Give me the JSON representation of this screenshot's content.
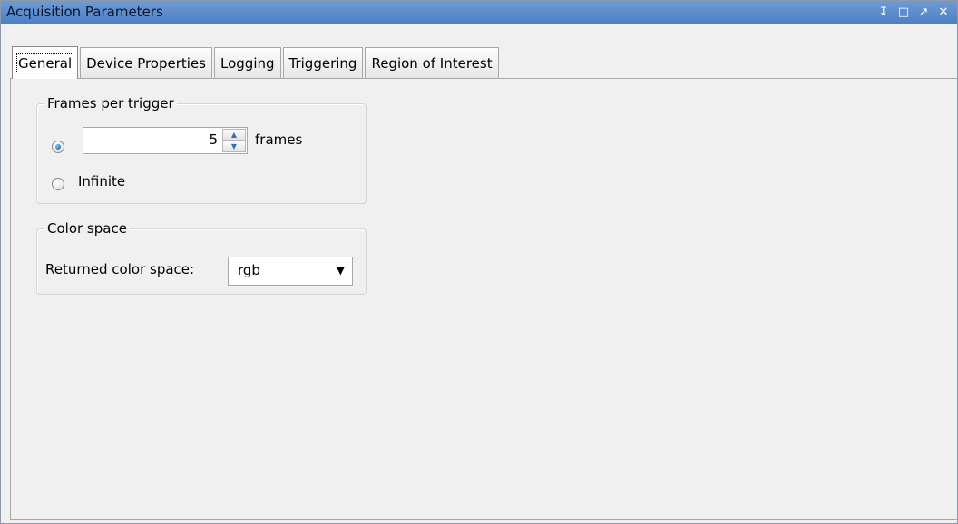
{
  "window": {
    "title": "Acquisition Parameters",
    "controls": [
      "↧",
      "□",
      "↗",
      "✕"
    ]
  },
  "tabs": [
    {
      "label": "General",
      "active": true
    },
    {
      "label": "Device Properties",
      "active": false
    },
    {
      "label": "Logging",
      "active": false
    },
    {
      "label": "Triggering",
      "active": false
    },
    {
      "label": "Region of Interest",
      "active": false
    }
  ],
  "frames_group": {
    "legend": "Frames per trigger",
    "frames_value": "5",
    "frames_unit": "frames",
    "infinite_label": "Infinite",
    "selected": "frames"
  },
  "color_group": {
    "legend": "Color space",
    "returned_label": "Returned color space:",
    "returned_value": "rgb"
  }
}
